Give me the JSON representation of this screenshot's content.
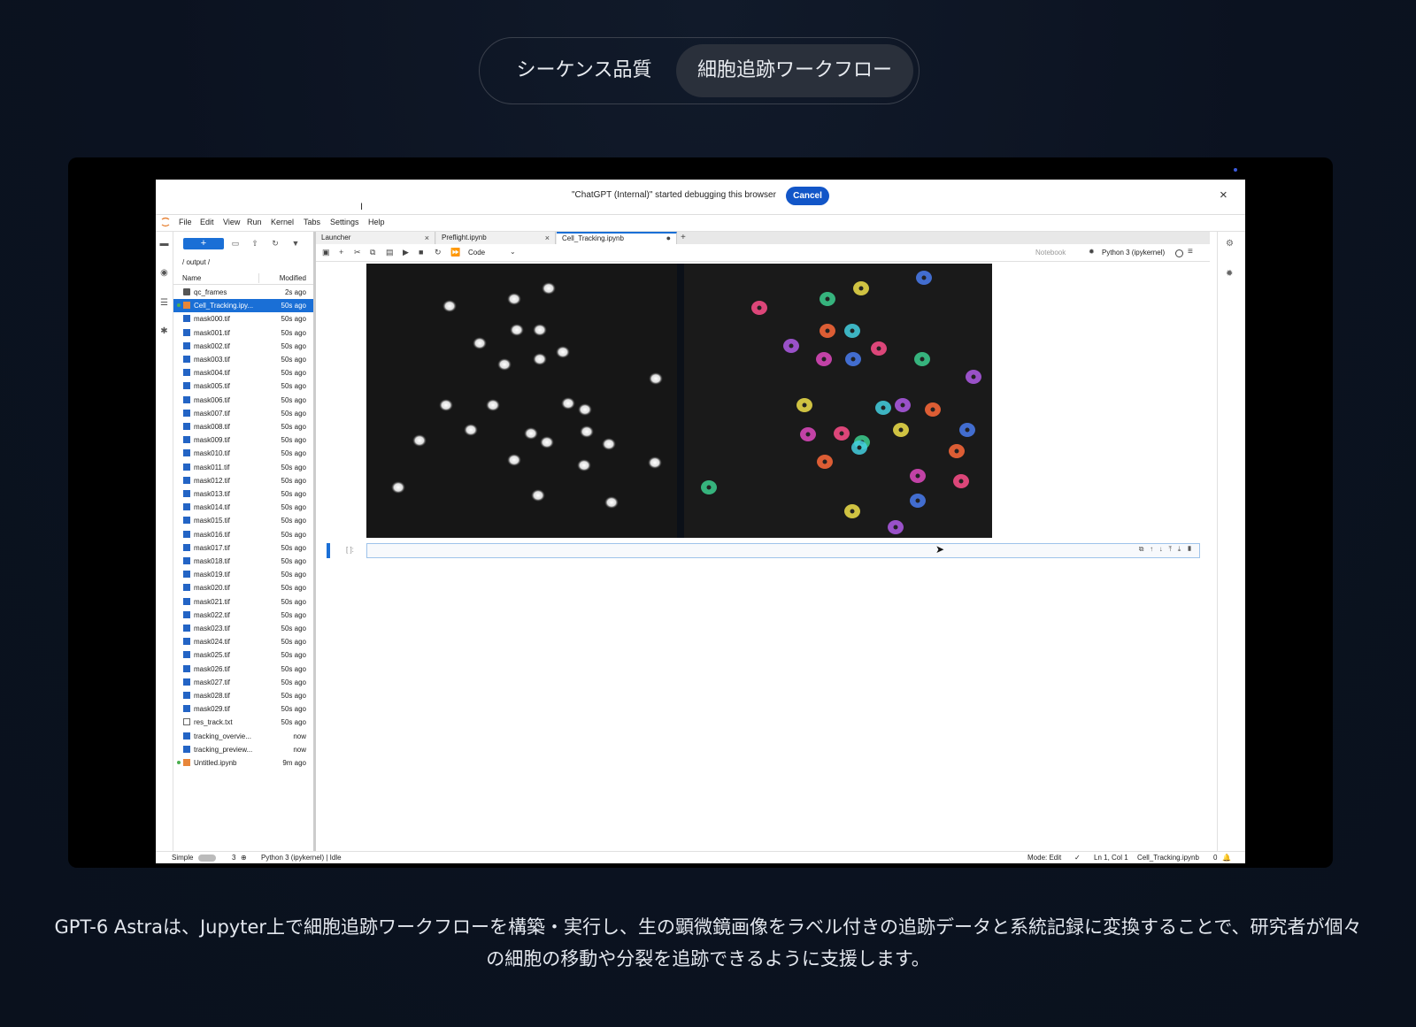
{
  "segmented": {
    "options": [
      "シーケンス品質",
      "細胞追跡ワークフロー"
    ],
    "selected_index": 1
  },
  "debug_banner": {
    "message": "\"ChatGPT (Internal)\" started debugging this browser",
    "cancel_label": "Cancel",
    "close_glyph": "×"
  },
  "menu": [
    "File",
    "Edit",
    "View",
    "Run",
    "Kernel",
    "Tabs",
    "Settings",
    "Help"
  ],
  "file_browser": {
    "new_label": "+",
    "path": "/ output /",
    "col_name": "Name",
    "col_modified": "Modified",
    "files": [
      {
        "name": "qc_frames",
        "modified": "2s ago",
        "kind": "folder"
      },
      {
        "name": "Cell_Tracking.ipy...",
        "modified": "50s ago",
        "kind": "notebook",
        "selected": true,
        "running": true
      },
      {
        "name": "mask000.tif",
        "modified": "50s ago",
        "kind": "image"
      },
      {
        "name": "mask001.tif",
        "modified": "50s ago",
        "kind": "image"
      },
      {
        "name": "mask002.tif",
        "modified": "50s ago",
        "kind": "image"
      },
      {
        "name": "mask003.tif",
        "modified": "50s ago",
        "kind": "image"
      },
      {
        "name": "mask004.tif",
        "modified": "50s ago",
        "kind": "image"
      },
      {
        "name": "mask005.tif",
        "modified": "50s ago",
        "kind": "image"
      },
      {
        "name": "mask006.tif",
        "modified": "50s ago",
        "kind": "image"
      },
      {
        "name": "mask007.tif",
        "modified": "50s ago",
        "kind": "image"
      },
      {
        "name": "mask008.tif",
        "modified": "50s ago",
        "kind": "image"
      },
      {
        "name": "mask009.tif",
        "modified": "50s ago",
        "kind": "image"
      },
      {
        "name": "mask010.tif",
        "modified": "50s ago",
        "kind": "image"
      },
      {
        "name": "mask011.tif",
        "modified": "50s ago",
        "kind": "image"
      },
      {
        "name": "mask012.tif",
        "modified": "50s ago",
        "kind": "image"
      },
      {
        "name": "mask013.tif",
        "modified": "50s ago",
        "kind": "image"
      },
      {
        "name": "mask014.tif",
        "modified": "50s ago",
        "kind": "image"
      },
      {
        "name": "mask015.tif",
        "modified": "50s ago",
        "kind": "image"
      },
      {
        "name": "mask016.tif",
        "modified": "50s ago",
        "kind": "image"
      },
      {
        "name": "mask017.tif",
        "modified": "50s ago",
        "kind": "image"
      },
      {
        "name": "mask018.tif",
        "modified": "50s ago",
        "kind": "image"
      },
      {
        "name": "mask019.tif",
        "modified": "50s ago",
        "kind": "image"
      },
      {
        "name": "mask020.tif",
        "modified": "50s ago",
        "kind": "image"
      },
      {
        "name": "mask021.tif",
        "modified": "50s ago",
        "kind": "image"
      },
      {
        "name": "mask022.tif",
        "modified": "50s ago",
        "kind": "image"
      },
      {
        "name": "mask023.tif",
        "modified": "50s ago",
        "kind": "image"
      },
      {
        "name": "mask024.tif",
        "modified": "50s ago",
        "kind": "image"
      },
      {
        "name": "mask025.tif",
        "modified": "50s ago",
        "kind": "image"
      },
      {
        "name": "mask026.tif",
        "modified": "50s ago",
        "kind": "image"
      },
      {
        "name": "mask027.tif",
        "modified": "50s ago",
        "kind": "image"
      },
      {
        "name": "mask028.tif",
        "modified": "50s ago",
        "kind": "image"
      },
      {
        "name": "mask029.tif",
        "modified": "50s ago",
        "kind": "image"
      },
      {
        "name": "res_track.txt",
        "modified": "50s ago",
        "kind": "text"
      },
      {
        "name": "tracking_overvie...",
        "modified": "now",
        "kind": "image"
      },
      {
        "name": "tracking_preview...",
        "modified": "now",
        "kind": "image"
      },
      {
        "name": "Untitled.ipynb",
        "modified": "9m ago",
        "kind": "notebook",
        "running": true
      }
    ]
  },
  "tabs": [
    {
      "label": "Launcher"
    },
    {
      "label": "Preflight.ipynb"
    },
    {
      "label": "Cell_Tracking.ipynb",
      "active": true
    }
  ],
  "notebook_toolbar": {
    "cell_type": "Code",
    "notebook_label": "Notebook",
    "kernel": "Python 3 (ipykernel)"
  },
  "cell": {
    "prompt": "[ ]:"
  },
  "status_bar": {
    "simple_label": "Simple",
    "count": "3",
    "kernel_status": "Python 3 (ipykernel) | Idle",
    "mode": "Mode: Edit",
    "position": "Ln 1, Col 1",
    "file": "Cell_Tracking.ipynb",
    "notifications": "0"
  },
  "caption": "GPT-6 Astraは、Jupyter上で細胞追跡ワークフローを構築・実行し、生の顕微鏡画像をラベル付きの追跡データと系統記録に変換することで、研究者が個々の細胞の移動や分裂を追跡できるように支援します。",
  "colors": {
    "accent": "#1a6fd6",
    "cancel": "#1256c8",
    "page_bg": "#0b1220"
  }
}
